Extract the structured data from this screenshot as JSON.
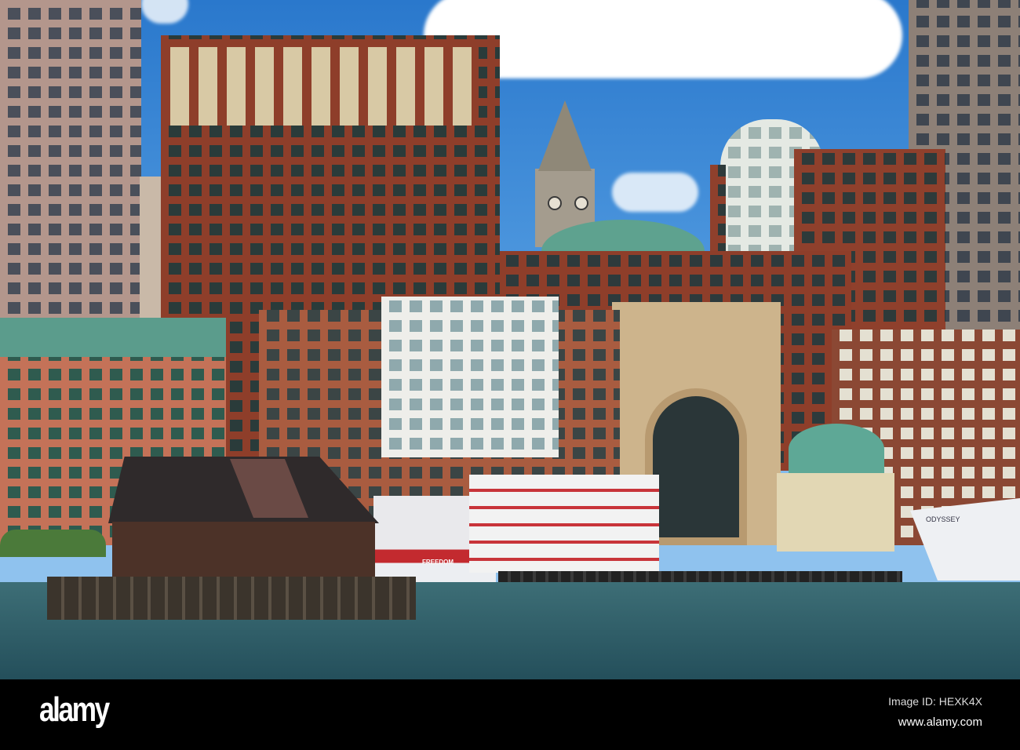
{
  "scene": {
    "description_colors": {
      "sky": "#2a78cc",
      "brick": "#8e3e2a",
      "water": "#2b5a66",
      "dome": "#5fa896"
    },
    "boat_labels": {
      "freedom": "FREEDOM",
      "odyssey": "ODYSSEY"
    }
  },
  "watermark": {
    "logo": "alamy",
    "image_id": "Image ID: HEXK4X",
    "url": "www.alamy.com"
  }
}
